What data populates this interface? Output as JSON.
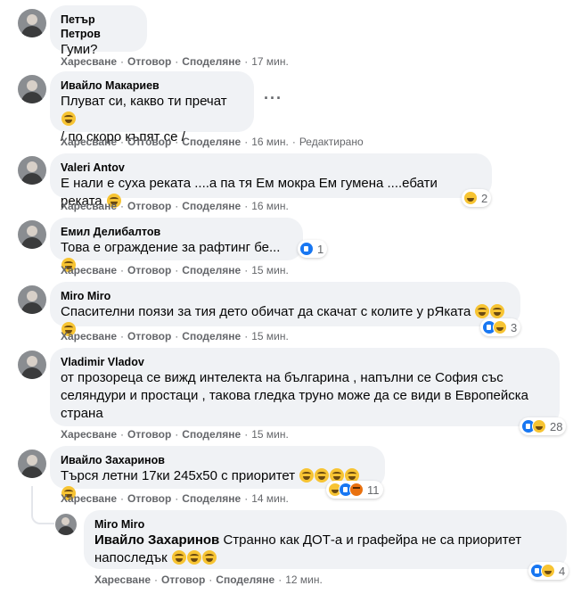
{
  "actions": {
    "like": "Харесване",
    "reply": "Отговор",
    "share": "Споделяне",
    "dot": "·"
  },
  "more_icon": "more-horizontal-icon",
  "colors": {
    "bubble": "#f0f2f5",
    "meta": "#65676b",
    "like": "#1877f2",
    "haha": "#f7c433",
    "angry": "#e9710f"
  },
  "comments": [
    {
      "author": "Петър Петров",
      "text": "Гуми?",
      "time": "17 мин."
    },
    {
      "author": "Ивайло Макариев",
      "line1": "Плуват си, какво ти пречат",
      "line2": "/ по скоро къпят се /",
      "time": "16 мин.",
      "edited": "Редактирано"
    },
    {
      "author": "Valeri Antov",
      "text": "Е нали е суха реката ....а па тя Ем мокра Ем гумена ....ебати реката",
      "time": "16 мин.",
      "reactions": "2"
    },
    {
      "author": "Емил Делибалтов",
      "text": "Това е ограждение за рафтинг бе...",
      "time": "15 мин.",
      "reactions": "1"
    },
    {
      "author": "Miro Miro",
      "text": "Спасителни поязи за тия дето обичат да скачат с колите у рЯката",
      "time": "15 мин.",
      "reactions": "3"
    },
    {
      "author": "Vladimir Vladov",
      "line1": "от прозореца се вижд интелекта на българина , напълни се София със",
      "line2": "селяндури и простаци , такова гледка труно може да се види в Европейска",
      "line3": "страна",
      "time": "15 мин.",
      "reactions": "28"
    },
    {
      "author": "Ивайло Захаринов",
      "text": "Търся летни 17ки 245х50 с приоритет",
      "time": "14 мин.",
      "reactions": "11"
    },
    {
      "author": "Miro Miro",
      "mention": "Ивайло Захаринов",
      "line1": "Странно как ДОТ-а и графейра не са приоритет",
      "line2": "напоследък",
      "time": "12 мин.",
      "reactions": "4"
    }
  ]
}
